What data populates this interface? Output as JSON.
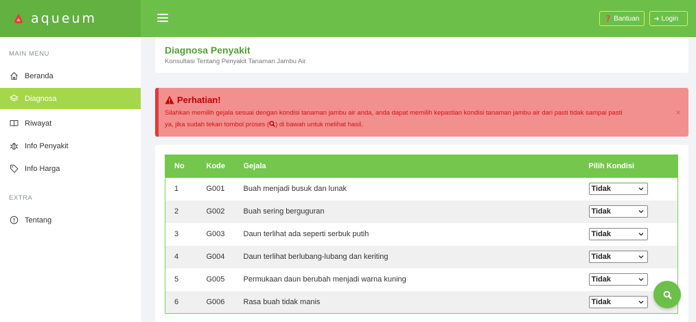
{
  "app": {
    "brand": "aqueum"
  },
  "header": {
    "help_label": "Bantuan",
    "login_label": "Login"
  },
  "sidebar": {
    "main_header": "MAIN MENU",
    "extra_header": "EXTRA",
    "items": [
      {
        "label": "Beranda",
        "icon": "home-icon"
      },
      {
        "label": "Diagnosa",
        "icon": "layers-icon",
        "active": true
      },
      {
        "label": "Riwayat",
        "icon": "book-icon"
      },
      {
        "label": "Info Penyakit",
        "icon": "bug-icon"
      },
      {
        "label": "Info Harga",
        "icon": "tag-icon"
      },
      {
        "label": "Tentang",
        "icon": "info-icon"
      }
    ]
  },
  "page": {
    "title": "Diagnosa Penyakit",
    "subtitle": "Konsultasi Tentang Penyakit Tanaman Jambu Air"
  },
  "alert": {
    "title": "Perhatian!",
    "text_line1": "Silahkan memilih gejala sesuai dengan kondisi tanaman jambu air anda, anda dapat memilih kepastian kondisi tanaman jambu air dari pasti tidak sampai pasti",
    "text_line2_a": "ya, jika sudah tekan tombol proses (",
    "text_line2_b": ") di bawah untuk melihat hasil.",
    "close": "×"
  },
  "table": {
    "headers": {
      "no": "No",
      "kode": "Kode",
      "gejala": "Gejala",
      "kondisi": "Pilih Kondisi"
    },
    "rows": [
      {
        "no": "1",
        "kode": "G001",
        "gejala": "Buah menjadi busuk dan lunak",
        "kondisi": "Tidak"
      },
      {
        "no": "2",
        "kode": "G002",
        "gejala": "Buah sering berguguran",
        "kondisi": "Tidak"
      },
      {
        "no": "3",
        "kode": "G003",
        "gejala": "Daun terlihat ada seperti serbuk putih",
        "kondisi": "Tidak"
      },
      {
        "no": "4",
        "kode": "G004",
        "gejala": "Daun terlihat berlubang-lubang dan keriting",
        "kondisi": "Tidak"
      },
      {
        "no": "5",
        "kode": "G005",
        "gejala": "Permukaan daun berubah menjadi warna kuning",
        "kondisi": "Tidak"
      },
      {
        "no": "6",
        "kode": "G006",
        "gejala": "Rasa buah tidak manis",
        "kondisi": "Tidak"
      }
    ]
  },
  "colors": {
    "brand_green": "#6cc04a",
    "active_menu": "#a4d84a",
    "alert_bg": "#f28f8f",
    "alert_text": "#c81010"
  }
}
